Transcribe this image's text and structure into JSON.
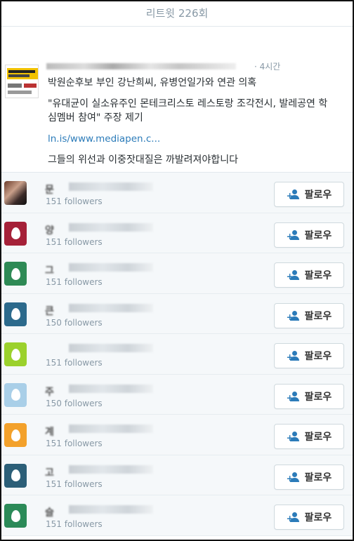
{
  "modal": {
    "title": "리트윗 226회"
  },
  "tweet": {
    "time": "· 4시간",
    "lines": [
      "박원순후보 부인 강난희씨, 유병언일가와 연관 의혹",
      "\"유대균이 실소유주인 몬테크리스토 레스토랑 조각전시, 발레공연 학",
      "심멤버 참여\" 주장 제기",
      "ln.is/www.mediapen.c...",
      "그들의 위선과 이중잣대질은 까발려져야합니다"
    ]
  },
  "follow_label": "팔로우",
  "users": [
    {
      "name": "문",
      "followers": "151 followers",
      "avatar_color": "#5a3a30",
      "egg": false
    },
    {
      "name": "양",
      "followers": "151 followers",
      "avatar_color": "#a52138",
      "egg": true
    },
    {
      "name": "그",
      "followers": "151 followers",
      "avatar_color": "#2e8a55",
      "egg": true
    },
    {
      "name": "큰",
      "followers": "150 followers",
      "avatar_color": "#2c6a8c",
      "egg": true
    },
    {
      "name": "",
      "followers": "151 followers",
      "avatar_color": "#9bd12c",
      "egg": true
    },
    {
      "name": "주",
      "followers": "150 followers",
      "avatar_color": "#a9cfe8",
      "egg": true
    },
    {
      "name": "계",
      "followers": "151 followers",
      "avatar_color": "#f3a12b",
      "egg": true
    },
    {
      "name": "고",
      "followers": "151 followers",
      "avatar_color": "#2c5f78",
      "egg": true
    },
    {
      "name": "슬",
      "followers": "151 followers",
      "avatar_color": "#2b8a58",
      "egg": true
    }
  ]
}
